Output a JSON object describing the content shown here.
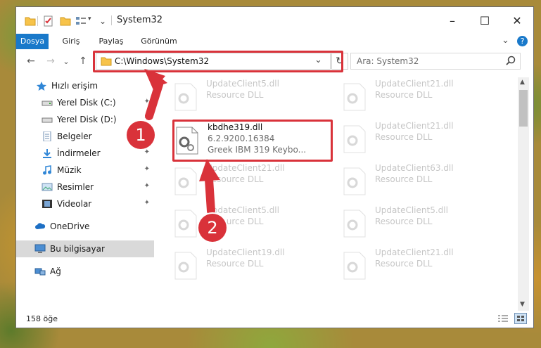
{
  "window": {
    "title": "System32",
    "minimize_label": "–",
    "maximize_label": "☐",
    "close_label": "✕"
  },
  "ribbon": {
    "tabs": [
      "Dosya",
      "Giriş",
      "Paylaş",
      "Görünüm"
    ],
    "help_label": "?",
    "expand_label": "⌄"
  },
  "nav": {
    "back_label": "←",
    "forward_label": "→",
    "recent_label": "⌄",
    "up_label": "↑",
    "path": "C:\\Windows\\System32",
    "dropdown_label": "⌄",
    "refresh_label": "↻",
    "search_placeholder": "Ara: System32"
  },
  "sidebar": {
    "items": [
      {
        "label": "Hızlı erişim",
        "icon": "star-icon"
      },
      {
        "label": "Yerel Disk (C:)",
        "icon": "drive-icon",
        "pinned": true
      },
      {
        "label": "Yerel Disk (D:)",
        "icon": "drive-icon",
        "pinned": true
      },
      {
        "label": "Belgeler",
        "icon": "documents-icon",
        "pinned": true
      },
      {
        "label": "İndirmeler",
        "icon": "download-icon",
        "pinned": true
      },
      {
        "label": "Müzik",
        "icon": "music-icon",
        "pinned": true
      },
      {
        "label": "Resimler",
        "icon": "pictures-icon",
        "pinned": true
      },
      {
        "label": "Videolar",
        "icon": "videos-icon",
        "pinned": true
      },
      {
        "label": "OneDrive",
        "icon": "cloud-icon"
      },
      {
        "label": "Bu bilgisayar",
        "icon": "computer-icon",
        "selected": true
      },
      {
        "label": "Ağ",
        "icon": "network-icon"
      }
    ],
    "pin_glyph": "📌"
  },
  "files": {
    "main": {
      "name": "kbdhe319.dll",
      "version": "6.2.9200.16384",
      "description": "Greek IBM 319 Keybo..."
    },
    "faded": [
      {
        "name": "UpdateClient5.dll",
        "sub": "Resource DLL"
      },
      {
        "name": "UpdateClient21.dll",
        "sub": "Resource DLL"
      },
      {
        "name": "UpdateClient21.dll",
        "sub": "Resource DLL"
      },
      {
        "name": "UpdateClient21.dll",
        "sub": "Resource DLL"
      },
      {
        "name": "UpdateClient63.dll",
        "sub": "Resource DLL"
      },
      {
        "name": "UpdateClient5.dll",
        "sub": "Resource DLL"
      },
      {
        "name": "UpdateClient5.dll",
        "sub": "Resource DLL"
      },
      {
        "name": "UpdateClient19.dll",
        "sub": "Resource DLL"
      },
      {
        "name": "UpdateClient21.dll",
        "sub": "Resource DLL"
      }
    ]
  },
  "status": {
    "count": "158 öğe"
  },
  "annotations": {
    "step1": "1",
    "step2": "2"
  },
  "colors": {
    "accent": "#1979ca",
    "annotation_red": "#d9323a"
  }
}
